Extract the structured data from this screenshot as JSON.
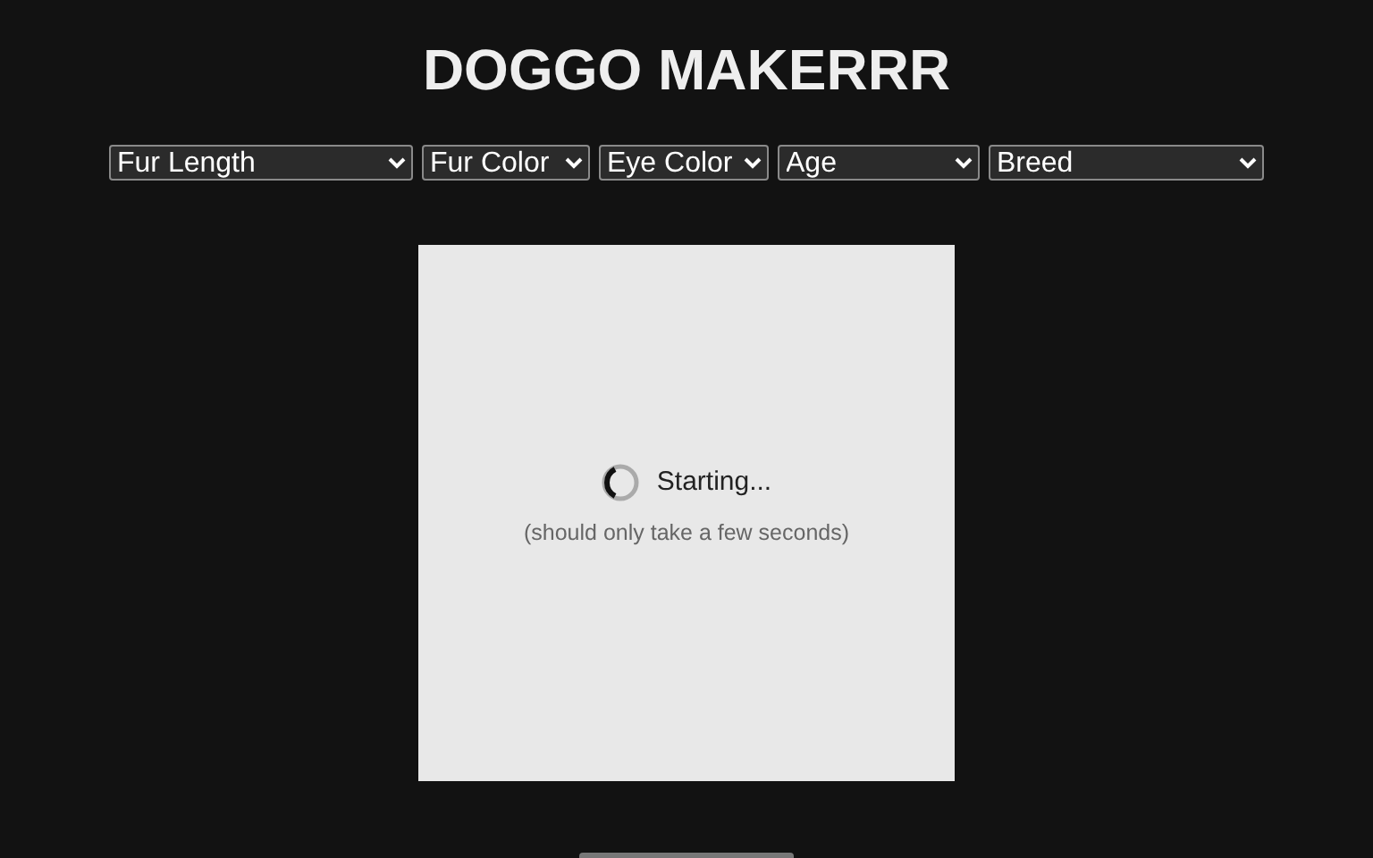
{
  "title": "DOGGO MAKERRR",
  "filters": [
    {
      "label": "Fur Length"
    },
    {
      "label": "Fur Color"
    },
    {
      "label": "Eye Color"
    },
    {
      "label": "Age"
    },
    {
      "label": "Breed"
    }
  ],
  "preview": {
    "status": "Starting...",
    "note": "(should only take a few seconds)"
  }
}
